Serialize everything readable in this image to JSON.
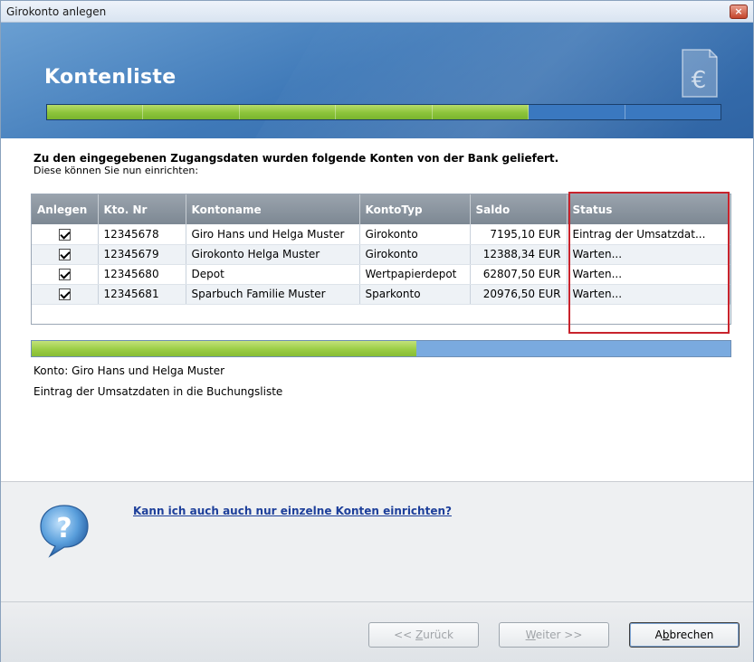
{
  "window": {
    "title": "Girokonto anlegen",
    "close_glyph": "×"
  },
  "header": {
    "title": "Kontenliste",
    "icon": "euro-document-icon",
    "steps": {
      "total": 7,
      "completed": 5
    }
  },
  "intro": {
    "heading": "Zu den eingegebenen Zugangsdaten wurden folgende Konten von der Bank geliefert.",
    "sub": "Diese können Sie nun einrichten:"
  },
  "table": {
    "columns": [
      "Anlegen",
      "Kto. Nr",
      "Kontoname",
      "KontoTyp",
      "Saldo",
      "Status"
    ],
    "rows": [
      {
        "checked": true,
        "number": "12345678",
        "name": "Giro Hans und Helga Muster",
        "type": "Girokonto",
        "saldo": "7195,10 EUR",
        "status": "Eintrag der Umsatzdat..."
      },
      {
        "checked": true,
        "number": "12345679",
        "name": "Girokonto Helga Muster",
        "type": "Girokonto",
        "saldo": "12388,34 EUR",
        "status": "Warten..."
      },
      {
        "checked": true,
        "number": "12345680",
        "name": "Depot",
        "type": "Wertpapierdepot",
        "saldo": "62807,50 EUR",
        "status": "Warten..."
      },
      {
        "checked": true,
        "number": "12345681",
        "name": "Sparbuch Familie Muster",
        "type": "Sparkonto",
        "saldo": "20976,50 EUR",
        "status": "Warten..."
      }
    ]
  },
  "progress": {
    "fraction": 0.55,
    "account_line": "Konto: Giro Hans und Helga Muster",
    "action_line": "Eintrag der Umsatzdaten in die Buchungsliste"
  },
  "help": {
    "icon": "question-bubble-icon",
    "link": "Kann ich auch auch nur einzelne Konten einrichten?"
  },
  "buttons": {
    "back": {
      "pre": "<< ",
      "underline": "Z",
      "post": "urück"
    },
    "next": {
      "pre": "",
      "underline": "W",
      "post": "eiter >>"
    },
    "cancel": {
      "pre": "A",
      "underline": "b",
      "post": "brechen"
    }
  },
  "colors": {
    "accent": "#3f79b8",
    "progress_green": "#9acd45",
    "highlight_red": "#c8232c",
    "link": "#1d3f9a"
  }
}
